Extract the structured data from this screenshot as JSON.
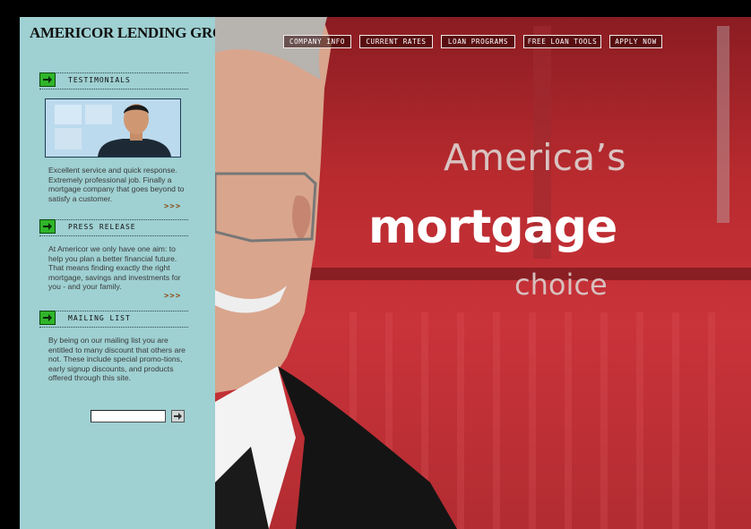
{
  "brand": {
    "name": "AMERICOR LENDING GROUP"
  },
  "nav": {
    "items": [
      {
        "label": "COMPANY INFO"
      },
      {
        "label": "CURRENT RATES"
      },
      {
        "label": "LOAN PROGRAMS"
      },
      {
        "label": "FREE LOAN TOOLS"
      },
      {
        "label": "APPLY NOW"
      }
    ]
  },
  "sidebar": {
    "testimonials": {
      "title": "TESTIMONIALS",
      "text": "Excellent service and quick response. Extremely professional job. Finally a mortgage company that goes beyond to satisfy a customer.",
      "more": ">>>"
    },
    "press": {
      "title": "PRESS RELEASE",
      "text": "At Americor we only have one aim: to help you plan a better financial future. That means finding exactly the right mortgage, savings and investments for you - and your family.",
      "more": ">>>"
    },
    "mailing": {
      "title": "MAILING LIST",
      "text": "By being on our mailing list you are entitled to many discount that others are not. These include special promo-tions, early signup discounts, and products offered through this site.",
      "email_value": ""
    }
  },
  "hero": {
    "line1": "America’s",
    "line2": "mortgage",
    "line3": "choice"
  },
  "colors": {
    "sidebar_bg": "#9fd0d2",
    "hero_red": "#c9333a",
    "arrow_green": "#2fb52a",
    "more_brown": "#8a4a12"
  },
  "icons": [
    "arrow-right-icon",
    "go-arrow-icon"
  ]
}
